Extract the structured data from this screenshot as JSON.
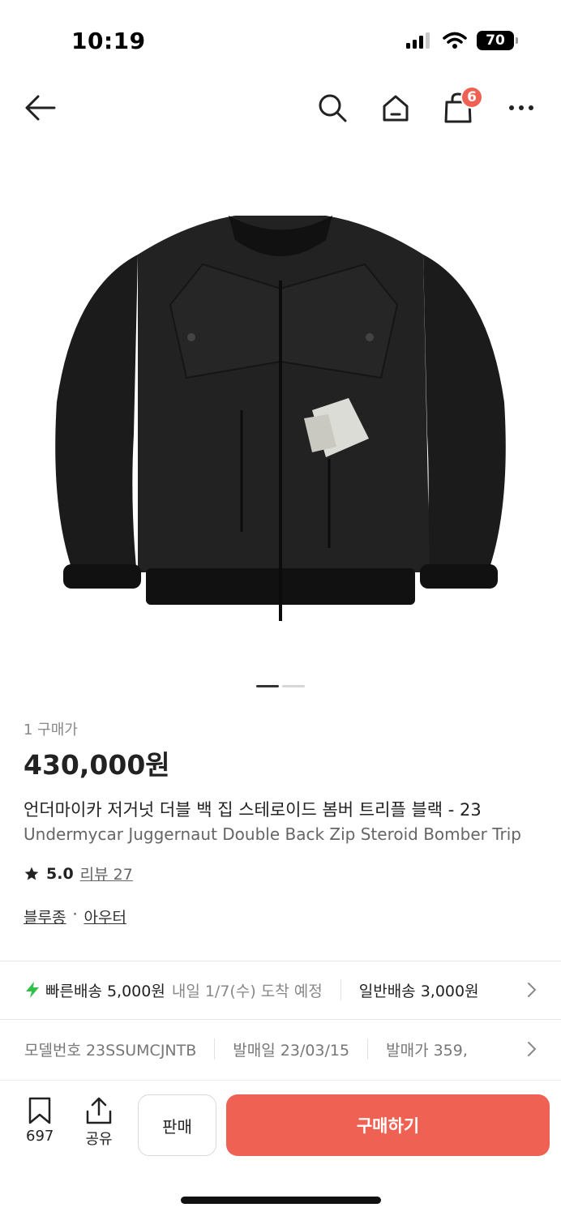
{
  "status_bar": {
    "time": "10:19",
    "battery": "70"
  },
  "nav": {
    "cart_count": "6"
  },
  "product": {
    "buyer_count": "1 구매가",
    "price": "430,000원",
    "title_ko": "언더마이카 저거넛 더블 백 집 스테로이드 봄버 트리플 블랙 - 23",
    "title_en": "Undermycar Juggernaut Double Back Zip Steroid Bomber Trip",
    "rating": "5.0",
    "review_label": "리뷰 27",
    "category_1": "블루종",
    "category_separator": "·",
    "category_2": "아우터"
  },
  "shipping": {
    "fast_label": "빠른배송 5,000원",
    "fast_date": "내일 1/7(수) 도착 예정",
    "normal_label": "일반배송 3,000원"
  },
  "meta": {
    "model": "모델번호 23SSUMCJNTB",
    "release": "발매일 23/03/15",
    "price": "발매가 359,"
  },
  "bottom_bar": {
    "wishlist_count": "697",
    "share_label": "공유",
    "sell_label": "판매",
    "buy_label": "구매하기"
  },
  "colors": {
    "accent": "#ef6253",
    "fast_ship": "#31c14a"
  }
}
